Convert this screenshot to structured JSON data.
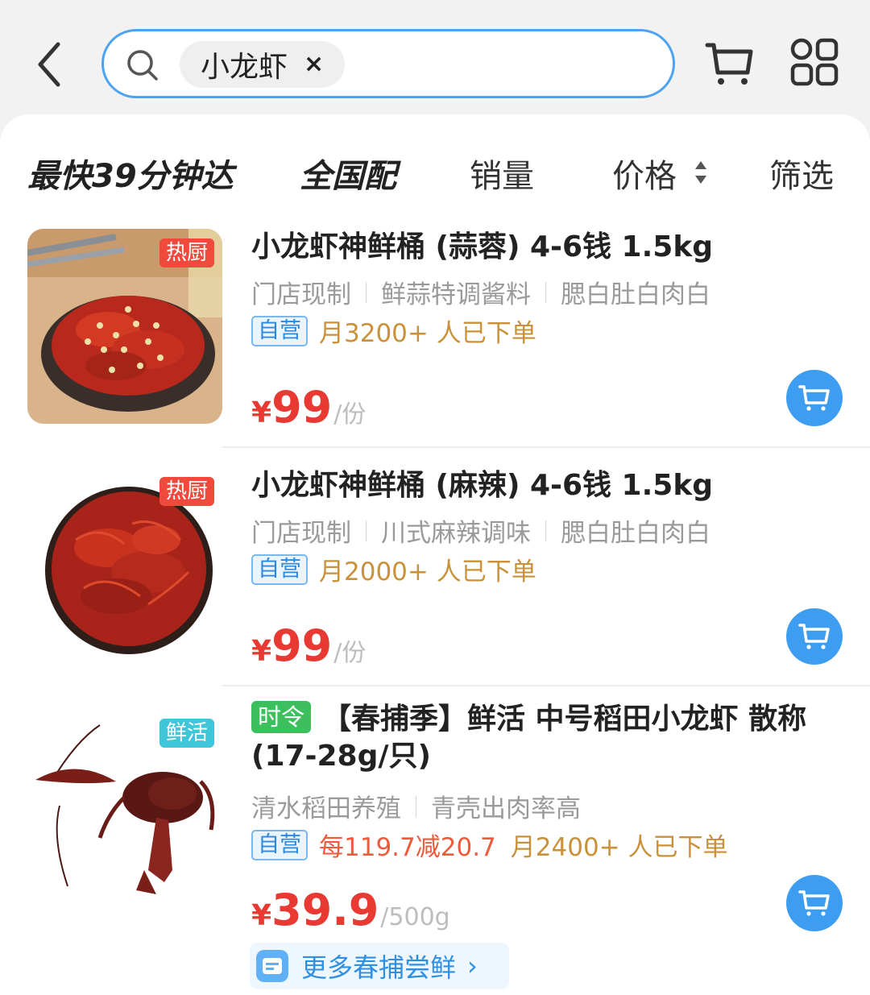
{
  "header": {
    "search_keyword": "小龙虾",
    "clear_label": "×"
  },
  "tabs": {
    "fastest": "最快39分钟达",
    "nationwide": "全国配",
    "sales": "销量",
    "price": "价格",
    "filter": "筛选"
  },
  "products": [
    {
      "badge": "热厨",
      "title": "小龙虾神鲜桶 (蒜蓉) 4-6钱 1.5kg",
      "tags": [
        "门店现制",
        "鲜蒜特调酱料",
        "腮白肚白肉白"
      ],
      "self_label": "自营",
      "monthly": "月3200+ 人已下单",
      "price_symbol": "¥",
      "price": "99",
      "unit": "/份"
    },
    {
      "badge": "热厨",
      "title": "小龙虾神鲜桶 (麻辣) 4-6钱 1.5kg",
      "tags": [
        "门店现制",
        "川式麻辣调味",
        "腮白肚白肉白"
      ],
      "self_label": "自营",
      "monthly": "月2000+ 人已下单",
      "price_symbol": "¥",
      "price": "99",
      "unit": "/份"
    },
    {
      "badge": "鲜活",
      "season_label": "时令",
      "title": "【春捕季】鲜活 中号稻田小龙虾 散称(17-28g/只)",
      "tags": [
        "清水稻田养殖",
        "青壳出肉率高"
      ],
      "self_label": "自营",
      "promo": "每119.7减20.7",
      "monthly": "月2400+ 人已下单",
      "price_symbol": "¥",
      "price": "39.9",
      "unit": "/500g",
      "more_label": "更多春捕尝鲜"
    }
  ],
  "colors": {
    "accent_blue": "#3d9df0",
    "price_red": "#e83a32",
    "monthly_gold": "#c9913a",
    "badge_red": "#f04a3c",
    "badge_teal": "#3fc6d9",
    "season_green": "#3dbf5e"
  }
}
